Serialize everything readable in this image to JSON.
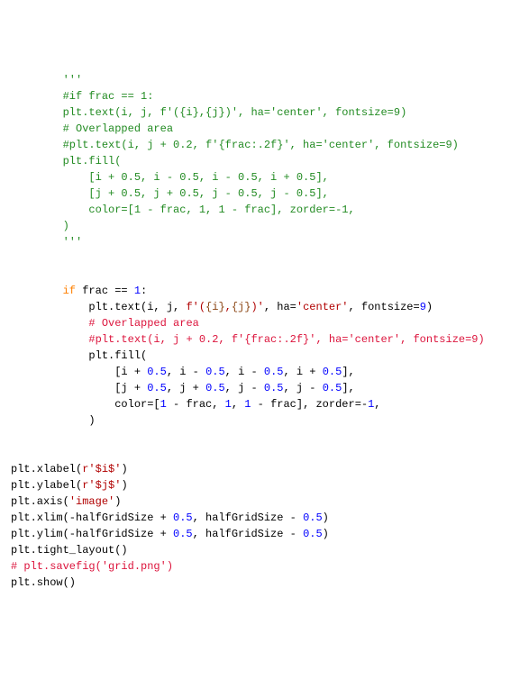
{
  "code": {
    "lines": [
      {
        "indent": 8,
        "segs": [
          {
            "t": "'''",
            "cls": "c-comg"
          }
        ]
      },
      {
        "indent": 8,
        "segs": [
          {
            "t": "#if frac == 1:",
            "cls": "c-comg"
          }
        ]
      },
      {
        "indent": 8,
        "segs": [
          {
            "t": "plt.text(i, j, f'({i},{j})', ha='center', fontsize=9)",
            "cls": "c-comg"
          }
        ]
      },
      {
        "indent": 8,
        "segs": [
          {
            "t": "# Overlapped area",
            "cls": "c-comg"
          }
        ]
      },
      {
        "indent": 8,
        "segs": [
          {
            "t": "#plt.text(i, j + 0.2, f'{frac:.2f}', ha='center', fontsize=9)",
            "cls": "c-comg"
          }
        ]
      },
      {
        "indent": 8,
        "segs": [
          {
            "t": "plt.fill(",
            "cls": "c-comg"
          }
        ]
      },
      {
        "indent": 12,
        "segs": [
          {
            "t": "[i + 0.5, i - 0.5, i - 0.5, i + 0.5],",
            "cls": "c-comg"
          }
        ]
      },
      {
        "indent": 12,
        "segs": [
          {
            "t": "[j + 0.5, j + 0.5, j - 0.5, j - 0.5],",
            "cls": "c-comg"
          }
        ]
      },
      {
        "indent": 12,
        "segs": [
          {
            "t": "color=[1 - frac, 1, 1 - frac], zorder=-1,",
            "cls": "c-comg"
          }
        ]
      },
      {
        "indent": 8,
        "segs": [
          {
            "t": ")",
            "cls": "c-comg"
          }
        ]
      },
      {
        "indent": 8,
        "segs": [
          {
            "t": "'''",
            "cls": "c-comg"
          }
        ]
      },
      {
        "indent": 0,
        "segs": []
      },
      {
        "indent": 0,
        "segs": []
      },
      {
        "indent": 8,
        "segs": [
          {
            "t": "if",
            "cls": "c-kw"
          },
          {
            "t": " frac == "
          },
          {
            "t": "1",
            "cls": "c-num"
          },
          {
            "t": ":"
          }
        ]
      },
      {
        "indent": 12,
        "segs": [
          {
            "t": "plt.text(i, j, "
          },
          {
            "t": "f'(",
            "cls": "c-str"
          },
          {
            "t": "{i}",
            "cls": "c-strf"
          },
          {
            "t": ",",
            "cls": "c-str"
          },
          {
            "t": "{j}",
            "cls": "c-strf"
          },
          {
            "t": ")'",
            "cls": "c-str"
          },
          {
            "t": ", ha="
          },
          {
            "t": "'center'",
            "cls": "c-str"
          },
          {
            "t": ", fontsize="
          },
          {
            "t": "9",
            "cls": "c-num"
          },
          {
            "t": ")"
          }
        ]
      },
      {
        "indent": 12,
        "segs": [
          {
            "t": "# Overlapped area",
            "cls": "c-com"
          }
        ]
      },
      {
        "indent": 12,
        "segs": [
          {
            "t": "#plt.text(i, j + 0.2, f'{frac:.2f}', ha='center', fontsize=9)",
            "cls": "c-com"
          }
        ]
      },
      {
        "indent": 12,
        "segs": [
          {
            "t": "plt.fill("
          }
        ]
      },
      {
        "indent": 16,
        "segs": [
          {
            "t": "[i + "
          },
          {
            "t": "0.5",
            "cls": "c-num"
          },
          {
            "t": ", i - "
          },
          {
            "t": "0.5",
            "cls": "c-num"
          },
          {
            "t": ", i - "
          },
          {
            "t": "0.5",
            "cls": "c-num"
          },
          {
            "t": ", i + "
          },
          {
            "t": "0.5",
            "cls": "c-num"
          },
          {
            "t": "],"
          }
        ]
      },
      {
        "indent": 16,
        "segs": [
          {
            "t": "[j + "
          },
          {
            "t": "0.5",
            "cls": "c-num"
          },
          {
            "t": ", j + "
          },
          {
            "t": "0.5",
            "cls": "c-num"
          },
          {
            "t": ", j - "
          },
          {
            "t": "0.5",
            "cls": "c-num"
          },
          {
            "t": ", j - "
          },
          {
            "t": "0.5",
            "cls": "c-num"
          },
          {
            "t": "],"
          }
        ]
      },
      {
        "indent": 16,
        "segs": [
          {
            "t": "color=["
          },
          {
            "t": "1",
            "cls": "c-num"
          },
          {
            "t": " - frac, "
          },
          {
            "t": "1",
            "cls": "c-num"
          },
          {
            "t": ", "
          },
          {
            "t": "1",
            "cls": "c-num"
          },
          {
            "t": " - frac], zorder=-"
          },
          {
            "t": "1",
            "cls": "c-num"
          },
          {
            "t": ","
          }
        ]
      },
      {
        "indent": 12,
        "segs": [
          {
            "t": ")"
          }
        ]
      },
      {
        "indent": 0,
        "segs": []
      },
      {
        "indent": 0,
        "segs": []
      },
      {
        "indent": 0,
        "segs": [
          {
            "t": "plt.xlabel("
          },
          {
            "t": "r'$i$'",
            "cls": "c-str"
          },
          {
            "t": ")"
          }
        ]
      },
      {
        "indent": 0,
        "segs": [
          {
            "t": "plt.ylabel("
          },
          {
            "t": "r'$j$'",
            "cls": "c-str"
          },
          {
            "t": ")"
          }
        ]
      },
      {
        "indent": 0,
        "segs": [
          {
            "t": "plt.axis("
          },
          {
            "t": "'image'",
            "cls": "c-str"
          },
          {
            "t": ")"
          }
        ]
      },
      {
        "indent": 0,
        "segs": [
          {
            "t": "plt.xlim(-halfGridSize + "
          },
          {
            "t": "0.5",
            "cls": "c-num"
          },
          {
            "t": ", halfGridSize - "
          },
          {
            "t": "0.5",
            "cls": "c-num"
          },
          {
            "t": ")"
          }
        ]
      },
      {
        "indent": 0,
        "segs": [
          {
            "t": "plt.ylim(-halfGridSize + "
          },
          {
            "t": "0.5",
            "cls": "c-num"
          },
          {
            "t": ", halfGridSize - "
          },
          {
            "t": "0.5",
            "cls": "c-num"
          },
          {
            "t": ")"
          }
        ]
      },
      {
        "indent": 0,
        "segs": [
          {
            "t": "plt.tight_layout()"
          }
        ]
      },
      {
        "indent": 0,
        "segs": [
          {
            "t": "# plt.savefig('grid.png')",
            "cls": "c-com"
          }
        ]
      },
      {
        "indent": 0,
        "segs": [
          {
            "t": "plt.show()"
          }
        ]
      }
    ]
  }
}
